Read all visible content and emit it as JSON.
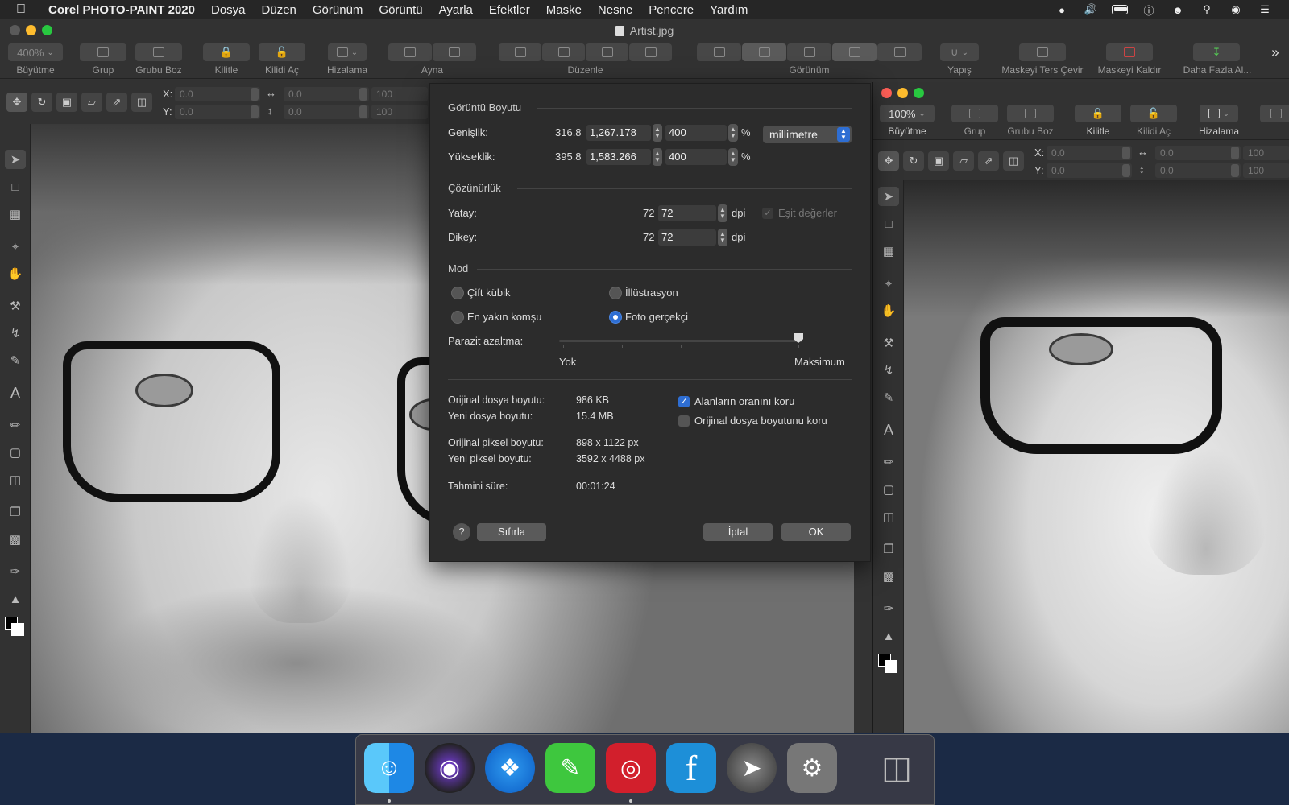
{
  "menubar": {
    "app_name": "Corel PHOTO-PAINT 2020",
    "items": [
      "Dosya",
      "Düzen",
      "Görünüm",
      "Görüntü",
      "Ayarla",
      "Efektler",
      "Maske",
      "Nesne",
      "Pencere",
      "Yardım"
    ]
  },
  "window": {
    "title": "Artist.jpg"
  },
  "toolbar": {
    "zoom_value": "400%",
    "labels": {
      "zoom": "Büyütme",
      "group": "Grup",
      "ungroup": "Grubu Boz",
      "lock": "Kilitle",
      "unlock": "Kilidi Aç",
      "align": "Hizalama",
      "mirror": "Ayna",
      "arrange": "Düzenle",
      "view": "Görünüm",
      "snap": "Yapış",
      "invert_mask": "Maskeyi Ters Çevir",
      "remove_mask": "Maskeyi Kaldır",
      "more": "Daha Fazla Al..."
    }
  },
  "propbar": {
    "x_label": "X:",
    "y_label": "Y:",
    "x_value": "0.0",
    "y_value": "0.0",
    "w_value": "0.0",
    "h_value": "0.0",
    "w_pct": "100",
    "h_pct": "100"
  },
  "dialog": {
    "image_size_heading": "Görüntü Boyutu",
    "width_label": "Genişlik:",
    "width_original": "316.8",
    "width_value": "1,267.178",
    "width_percent": "400",
    "height_label": "Yükseklik:",
    "height_original": "395.8",
    "height_value": "1,583.266",
    "height_percent": "400",
    "percent_sign": "%",
    "unit": "millimetre",
    "resolution_heading": "Çözünürlük",
    "horizontal_label": "Yatay:",
    "horizontal_original": "72",
    "horizontal_value": "72",
    "vertical_label": "Dikey:",
    "vertical_original": "72",
    "vertical_value": "72",
    "dpi": "dpi",
    "equal_values": "Eşit değerler",
    "mode_heading": "Mod",
    "modes": {
      "bicubic": "Çift kübik",
      "illustration": "İllüstrasyon",
      "nearest": "En yakın komşu",
      "photo": "Foto gerçekçi"
    },
    "selected_mode": "photo",
    "noise_label": "Parazit azaltma:",
    "noise_min": "Yok",
    "noise_max": "Maksimum",
    "noise_level": 1.0,
    "orig_file_size_label": "Orijinal dosya boyutu:",
    "orig_file_size": "986 KB",
    "new_file_size_label": "Yeni dosya boyutu:",
    "new_file_size": "15.4 MB",
    "orig_pixel_label": "Orijinal piksel boyutu:",
    "orig_pixel": "898 x 1122 px",
    "new_pixel_label": "Yeni piksel boyutu:",
    "new_pixel": "3592 x 4488 px",
    "est_time_label": "Tahmini süre:",
    "est_time": "00:01:24",
    "keep_ratio": "Alanların oranını koru",
    "keep_ratio_checked": true,
    "keep_orig_size": "Orijinal dosya boyutunu koru",
    "keep_orig_size_checked": false,
    "help": "?",
    "reset": "Sıfırla",
    "cancel": "İptal",
    "ok": "OK"
  },
  "win2": {
    "zoom_value": "100%",
    "labels": {
      "zoom": "Büyütme",
      "group": "Grup",
      "ungroup": "Grubu Boz",
      "lock": "Kilitle",
      "unlock": "Kilidi Aç",
      "align": "Hizalama"
    },
    "x_value": "0.0",
    "y_value": "0.0",
    "w_value": "0.0",
    "h_value": "0.0",
    "w_pct": "100",
    "h_pct": "100"
  },
  "colors": {
    "accent": "#2e6ed3",
    "close": "#fe5f57",
    "minimize": "#febc2e",
    "maximize": "#28c840"
  },
  "dock": {
    "apps": [
      "finder-icon",
      "siri-icon",
      "safari-icon",
      "pen-app-icon",
      "photo-booth-icon",
      "font-app-icon",
      "launchpad-icon",
      "system-preferences-icon",
      "trash-icon"
    ]
  }
}
